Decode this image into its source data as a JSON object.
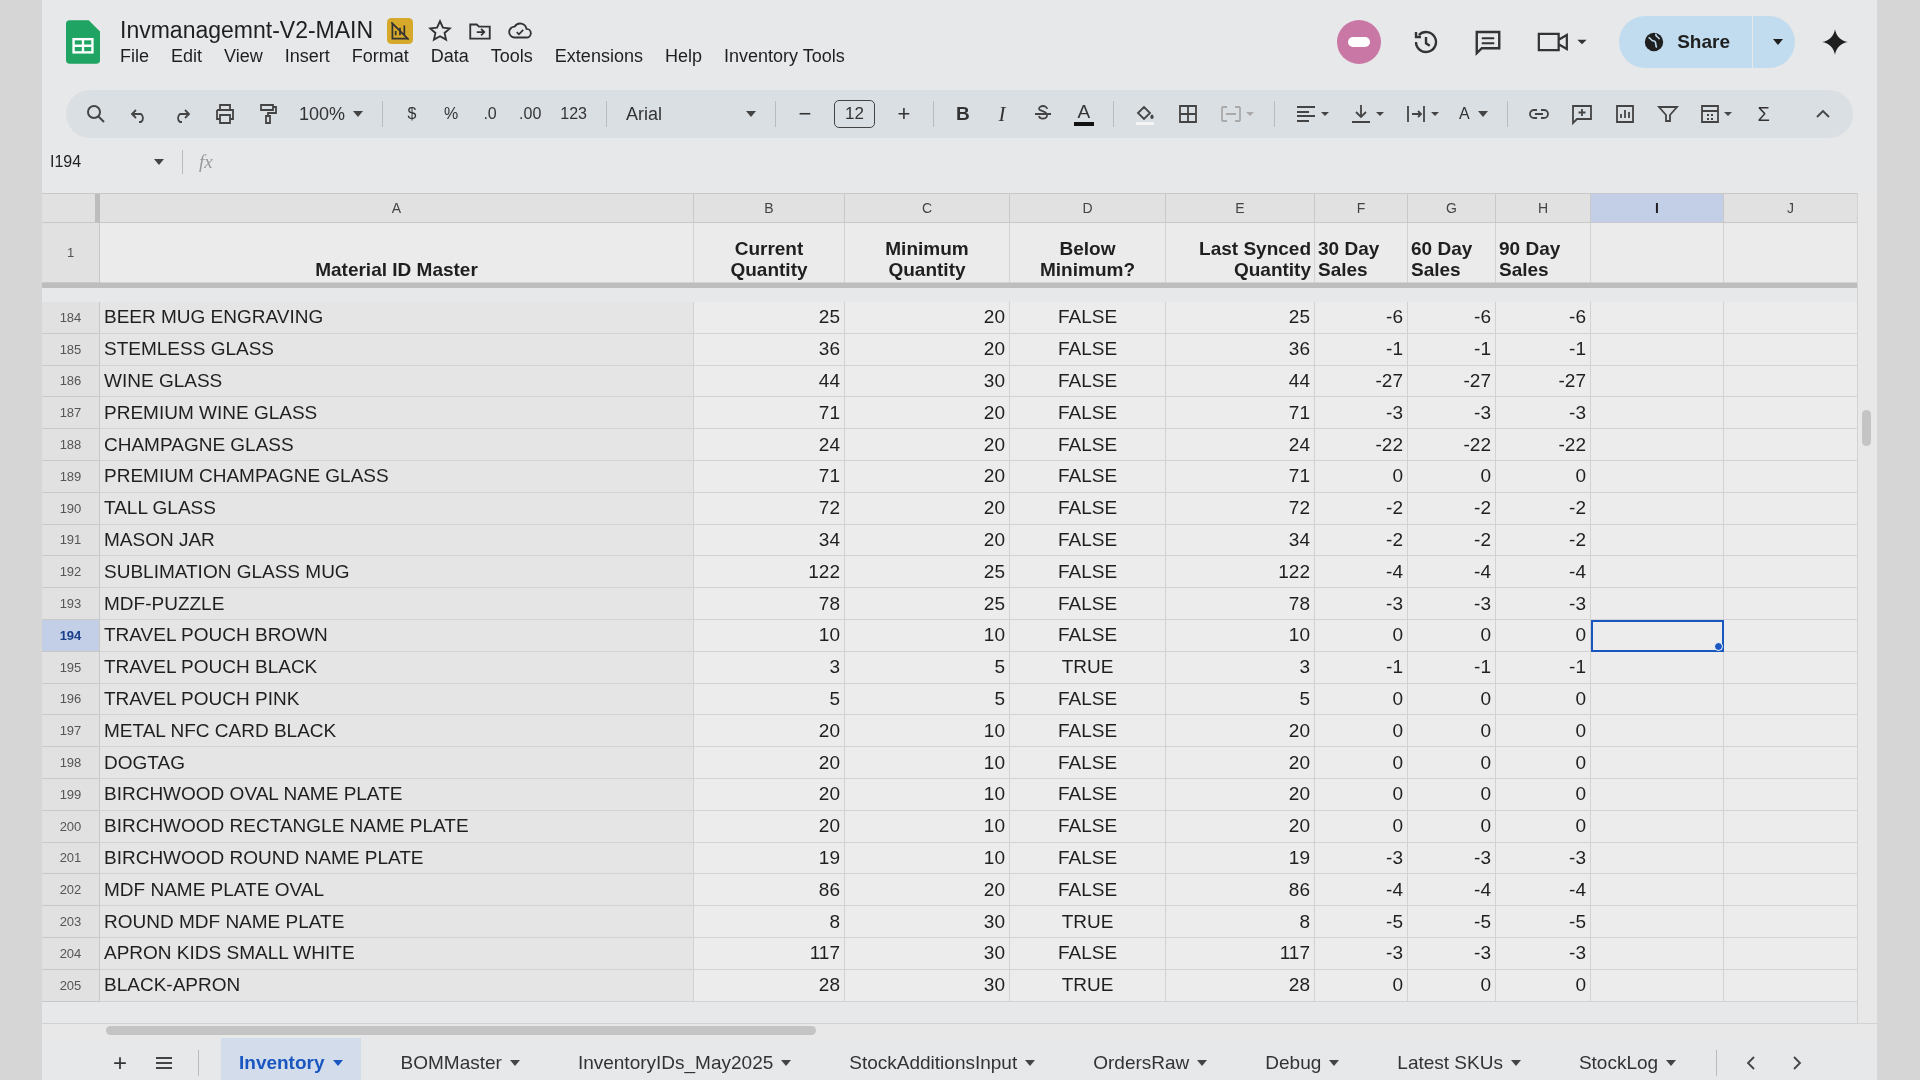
{
  "document": {
    "title": "Invmanagemnt-V2-MAIN"
  },
  "menu": [
    "File",
    "Edit",
    "View",
    "Insert",
    "Format",
    "Data",
    "Tools",
    "Extensions",
    "Help",
    "Inventory Tools"
  ],
  "share_button": {
    "label": "Share"
  },
  "toolbar": {
    "zoom": "100%",
    "number_formats": [
      "$",
      "%",
      ".0",
      ".00",
      "123"
    ],
    "font": "Arial",
    "font_size": "12",
    "decrease": "−",
    "increase": "+",
    "bold": "B",
    "italic": "I",
    "text_color": "A",
    "rotate": "A",
    "sum": "Σ"
  },
  "formula_bar": {
    "cell_ref": "I194",
    "fx": "fx"
  },
  "columns": [
    {
      "label": "A",
      "selected": false
    },
    {
      "label": "B",
      "selected": false
    },
    {
      "label": "C",
      "selected": false
    },
    {
      "label": "D",
      "selected": false
    },
    {
      "label": "E",
      "selected": false
    },
    {
      "label": "F",
      "selected": false
    },
    {
      "label": "G",
      "selected": false
    },
    {
      "label": "H",
      "selected": false
    },
    {
      "label": "I",
      "selected": true
    },
    {
      "label": "J",
      "selected": false
    }
  ],
  "header_row": {
    "number": "1",
    "cells": [
      "Material ID Master",
      "Current Quantity",
      "Minimum Quantity",
      "Below Minimum?",
      "Last Synced Quantity",
      "30 Day Sales",
      "60 Day Sales",
      "90 Day Sales"
    ]
  },
  "rows": [
    {
      "number": "184",
      "selected": false,
      "cells": [
        "BEER MUG ENGRAVING",
        "25",
        "20",
        "FALSE",
        "25",
        "-6",
        "-6",
        "-6"
      ]
    },
    {
      "number": "185",
      "selected": false,
      "cells": [
        "STEMLESS GLASS",
        "36",
        "20",
        "FALSE",
        "36",
        "-1",
        "-1",
        "-1"
      ]
    },
    {
      "number": "186",
      "selected": false,
      "cells": [
        "WINE GLASS",
        "44",
        "30",
        "FALSE",
        "44",
        "-27",
        "-27",
        "-27"
      ]
    },
    {
      "number": "187",
      "selected": false,
      "cells": [
        "PREMIUM WINE GLASS",
        "71",
        "20",
        "FALSE",
        "71",
        "-3",
        "-3",
        "-3"
      ]
    },
    {
      "number": "188",
      "selected": false,
      "cells": [
        "CHAMPAGNE GLASS",
        "24",
        "20",
        "FALSE",
        "24",
        "-22",
        "-22",
        "-22"
      ]
    },
    {
      "number": "189",
      "selected": false,
      "cells": [
        "PREMIUM CHAMPAGNE GLASS",
        "71",
        "20",
        "FALSE",
        "71",
        "0",
        "0",
        "0"
      ]
    },
    {
      "number": "190",
      "selected": false,
      "cells": [
        "TALL GLASS",
        "72",
        "20",
        "FALSE",
        "72",
        "-2",
        "-2",
        "-2"
      ]
    },
    {
      "number": "191",
      "selected": false,
      "cells": [
        "MASON JAR",
        "34",
        "20",
        "FALSE",
        "34",
        "-2",
        "-2",
        "-2"
      ]
    },
    {
      "number": "192",
      "selected": false,
      "cells": [
        "SUBLIMATION GLASS MUG",
        "122",
        "25",
        "FALSE",
        "122",
        "-4",
        "-4",
        "-4"
      ]
    },
    {
      "number": "193",
      "selected": false,
      "cells": [
        "MDF-PUZZLE",
        "78",
        "25",
        "FALSE",
        "78",
        "-3",
        "-3",
        "-3"
      ]
    },
    {
      "number": "194",
      "selected": true,
      "cells": [
        "TRAVEL POUCH BROWN",
        "10",
        "10",
        "FALSE",
        "10",
        "0",
        "0",
        "0"
      ]
    },
    {
      "number": "195",
      "selected": false,
      "cells": [
        "TRAVEL POUCH BLACK",
        "3",
        "5",
        "TRUE",
        "3",
        "-1",
        "-1",
        "-1"
      ]
    },
    {
      "number": "196",
      "selected": false,
      "cells": [
        "TRAVEL POUCH PINK",
        "5",
        "5",
        "FALSE",
        "5",
        "0",
        "0",
        "0"
      ]
    },
    {
      "number": "197",
      "selected": false,
      "cells": [
        "METAL NFC CARD BLACK",
        "20",
        "10",
        "FALSE",
        "20",
        "0",
        "0",
        "0"
      ]
    },
    {
      "number": "198",
      "selected": false,
      "cells": [
        "DOGTAG",
        "20",
        "10",
        "FALSE",
        "20",
        "0",
        "0",
        "0"
      ]
    },
    {
      "number": "199",
      "selected": false,
      "cells": [
        "BIRCHWOOD OVAL NAME PLATE",
        "20",
        "10",
        "FALSE",
        "20",
        "0",
        "0",
        "0"
      ]
    },
    {
      "number": "200",
      "selected": false,
      "cells": [
        "BIRCHWOOD RECTANGLE NAME PLATE",
        "20",
        "10",
        "FALSE",
        "20",
        "0",
        "0",
        "0"
      ]
    },
    {
      "number": "201",
      "selected": false,
      "cells": [
        "BIRCHWOOD ROUND NAME PLATE",
        "19",
        "10",
        "FALSE",
        "19",
        "-3",
        "-3",
        "-3"
      ]
    },
    {
      "number": "202",
      "selected": false,
      "cells": [
        "MDF NAME PLATE OVAL",
        "86",
        "20",
        "FALSE",
        "86",
        "-4",
        "-4",
        "-4"
      ]
    },
    {
      "number": "203",
      "selected": false,
      "cells": [
        "ROUND MDF NAME PLATE",
        "8",
        "30",
        "TRUE",
        "8",
        "-5",
        "-5",
        "-5"
      ]
    },
    {
      "number": "204",
      "selected": false,
      "cells": [
        "APRON KIDS SMALL WHITE",
        "117",
        "30",
        "FALSE",
        "117",
        "-3",
        "-3",
        "-3"
      ]
    },
    {
      "number": "205",
      "selected": false,
      "cells": [
        "BLACK-APRON",
        "28",
        "30",
        "TRUE",
        "28",
        "0",
        "0",
        "0"
      ]
    }
  ],
  "add_sheet": "+",
  "sheet_tabs": [
    {
      "label": "Inventory",
      "selected": true
    },
    {
      "label": "BOMMaster",
      "selected": false
    },
    {
      "label": "InventoryIDs_May2025",
      "selected": false
    },
    {
      "label": "StockAdditionsInput",
      "selected": false
    },
    {
      "label": "OrdersRaw",
      "selected": false
    },
    {
      "label": "Debug",
      "selected": false
    },
    {
      "label": "Latest SKUs",
      "selected": false
    },
    {
      "label": "StockLog",
      "selected": false
    }
  ]
}
